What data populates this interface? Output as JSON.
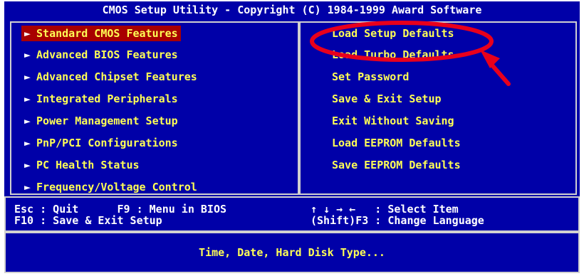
{
  "title": "CMOS Setup Utility - Copyright (C) 1984-1999 Award Software",
  "left_menu": [
    {
      "label": "Standard CMOS Features",
      "selected": true
    },
    {
      "label": "Advanced BIOS Features",
      "selected": false
    },
    {
      "label": "Advanced Chipset Features",
      "selected": false
    },
    {
      "label": "Integrated Peripherals",
      "selected": false
    },
    {
      "label": "Power Management Setup",
      "selected": false
    },
    {
      "label": "PnP/PCI Configurations",
      "selected": false
    },
    {
      "label": "PC Health Status",
      "selected": false
    },
    {
      "label": "Frequency/Voltage Control",
      "selected": false
    }
  ],
  "right_menu": [
    {
      "label": "Load Setup Defaults"
    },
    {
      "label": "Load Turbo Defaults"
    },
    {
      "label": "Set Password"
    },
    {
      "label": "Save & Exit Setup"
    },
    {
      "label": "Exit Without Saving"
    },
    {
      "label": "Load EEPROM Defaults"
    },
    {
      "label": "Save EEPROM Defaults"
    }
  ],
  "arrow_glyph": "►",
  "help": {
    "left_line1": "Esc : Quit      F9 : Menu in BIOS",
    "left_line2": "F10 : Save & Exit Setup",
    "right_line1": "↑ ↓ → ←   : Select Item",
    "right_line2": "(Shift)F3 : Change Language"
  },
  "status_text": "Time, Date, Hard Disk Type...",
  "colors": {
    "background": "#0000a8",
    "highlight": "#a80000",
    "text_yellow": "#ffff55",
    "text_white": "#ffffff",
    "annotation_red": "#e8001c"
  },
  "annotation": {
    "type": "red ellipse and arrow",
    "target": "Load Setup Defaults"
  }
}
